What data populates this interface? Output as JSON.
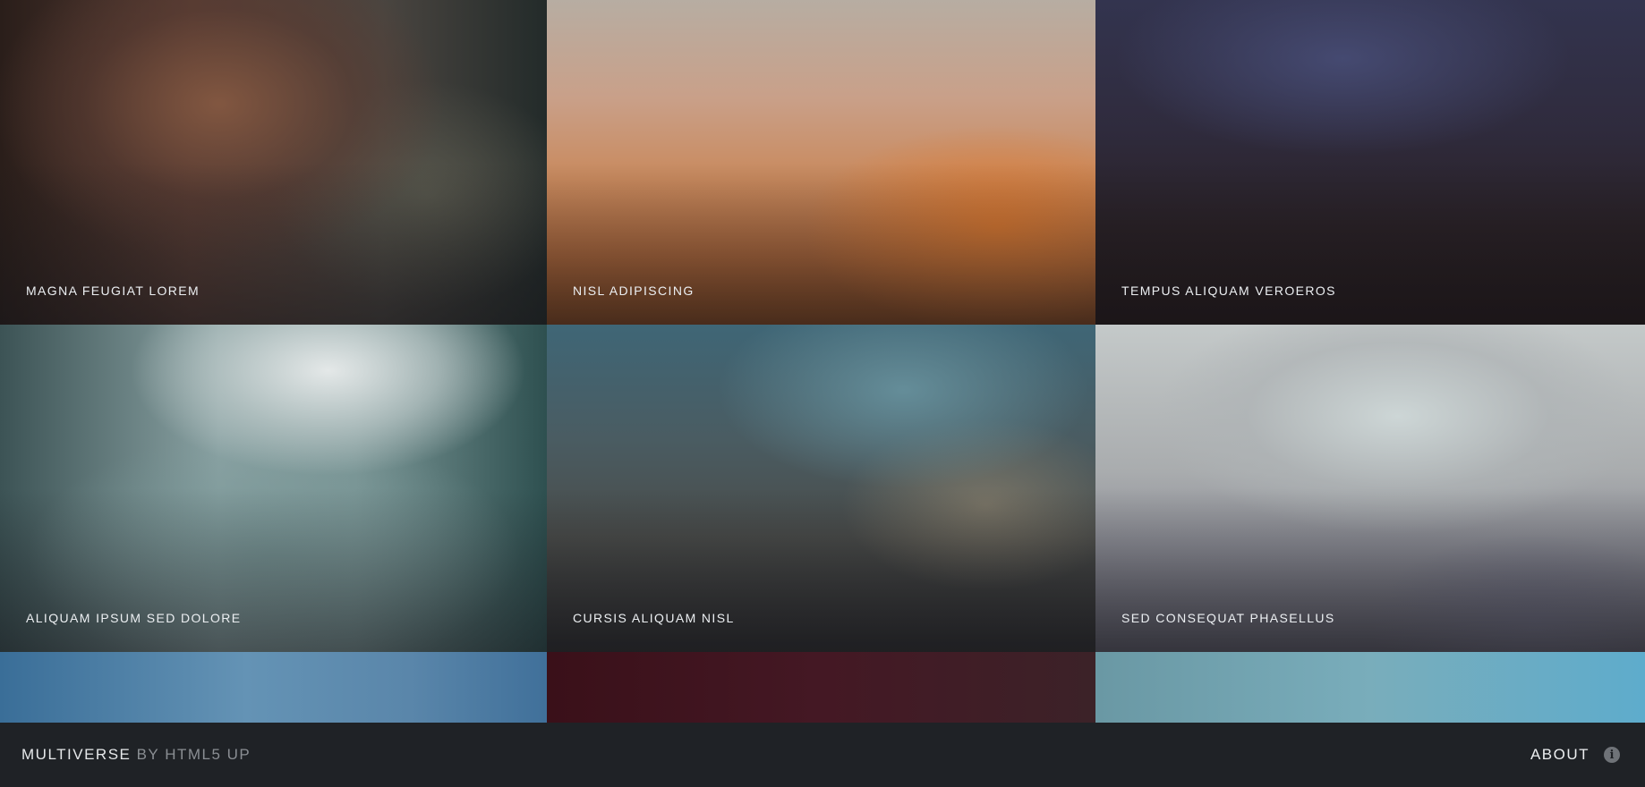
{
  "gallery": {
    "tiles": [
      {
        "caption": "MAGNA FEUGIAT LOREM"
      },
      {
        "caption": "NISL ADIPISCING"
      },
      {
        "caption": "TEMPUS ALIQUAM VEROEROS"
      },
      {
        "caption": "ALIQUAM IPSUM SED DOLORE"
      },
      {
        "caption": "CURSIS ALIQUAM NISL"
      },
      {
        "caption": "SED CONSEQUAT PHASELLUS"
      },
      {
        "caption": ""
      },
      {
        "caption": ""
      },
      {
        "caption": ""
      }
    ]
  },
  "footer": {
    "brand_name": "MULTIVERSE",
    "brand_by": " BY HTML5 UP",
    "about_label": "ABOUT",
    "about_icon": "info-icon"
  }
}
